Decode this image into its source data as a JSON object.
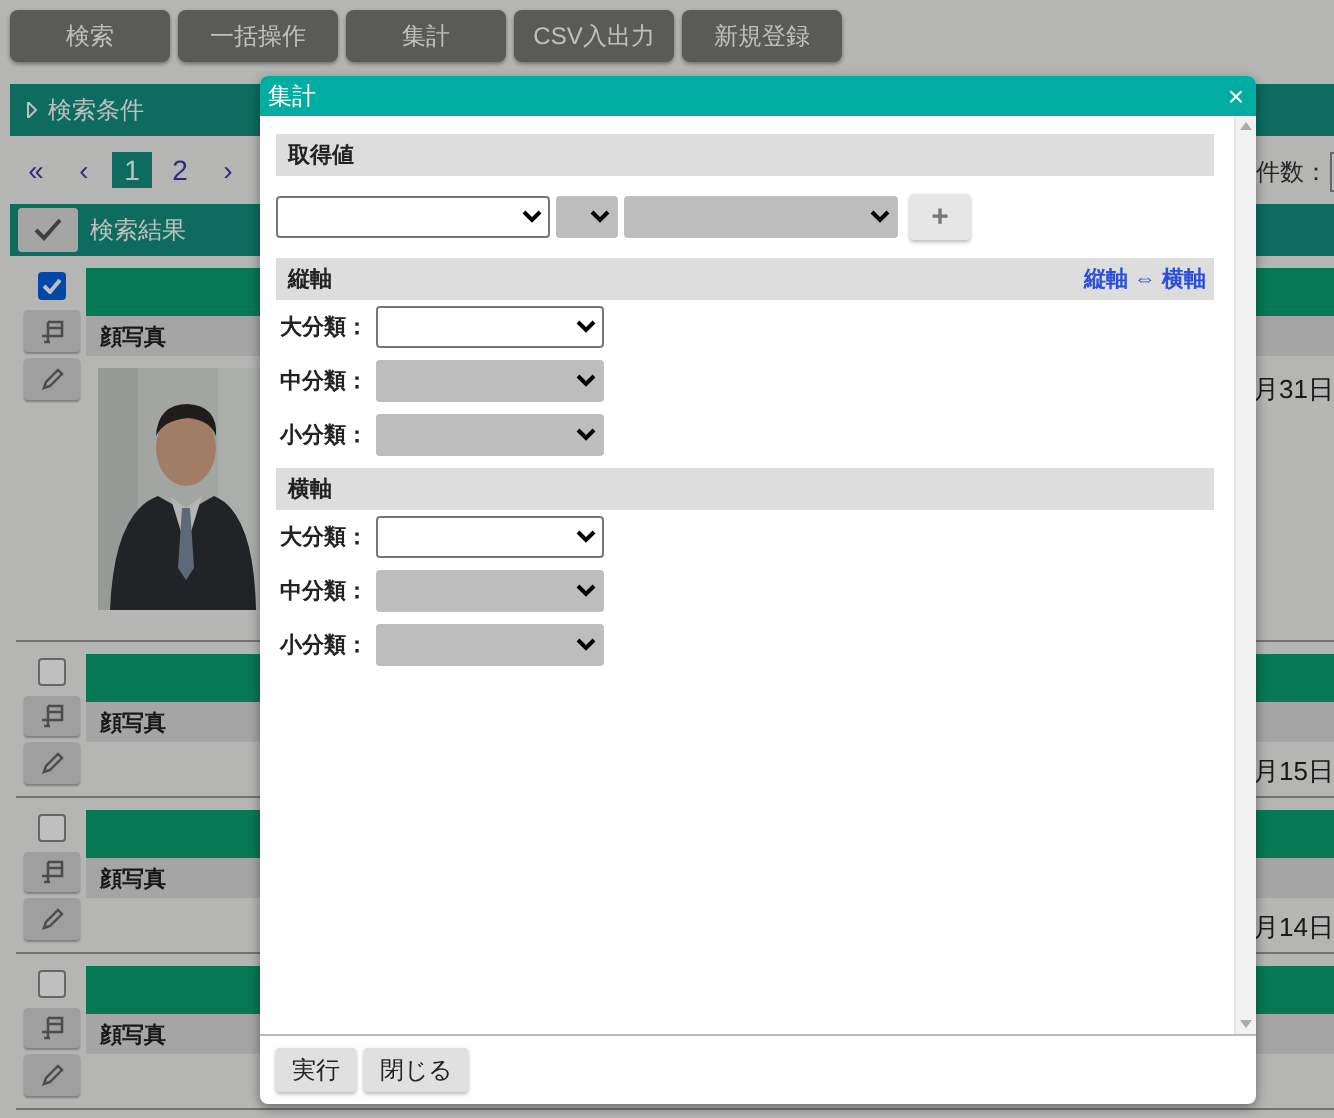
{
  "toolbar": {
    "buttons": [
      "検索",
      "一括操作",
      "集計",
      "CSV入出力",
      "新規登録"
    ]
  },
  "search_conditions": {
    "title": "検索条件",
    "expanded": false
  },
  "pagination": {
    "first": "«",
    "prev": "‹",
    "pages": [
      {
        "label": "1",
        "selected": true
      },
      {
        "label": "2",
        "selected": false
      }
    ],
    "next": "›",
    "count_label": "件数："
  },
  "results": {
    "title": "検索結果",
    "records": [
      {
        "checked": true,
        "photo_label": "顔写真",
        "date": "月31日"
      },
      {
        "checked": false,
        "photo_label": "顔写真",
        "date": "月15日"
      },
      {
        "checked": false,
        "photo_label": "顔写真",
        "date": "月14日"
      },
      {
        "checked": false,
        "photo_label": "顔写真"
      }
    ]
  },
  "dialog": {
    "title": "集計",
    "close": "×",
    "sections": [
      {
        "kind": "value",
        "title": "取得値",
        "add": "+",
        "selects": [
          {
            "disabled": false
          },
          {
            "disabled": true
          },
          {
            "disabled": true
          }
        ]
      },
      {
        "kind": "axis",
        "title": "縦軸",
        "swap_link": "縦軸 ⇔ 横軸",
        "fields": [
          {
            "label": "大分類：",
            "disabled": false
          },
          {
            "label": "中分類：",
            "disabled": true
          },
          {
            "label": "小分類：",
            "disabled": true
          }
        ]
      },
      {
        "kind": "axis",
        "title": "横軸",
        "fields": [
          {
            "label": "大分類：",
            "disabled": false
          },
          {
            "label": "中分類：",
            "disabled": true
          },
          {
            "label": "小分類：",
            "disabled": true
          }
        ]
      }
    ],
    "buttons": [
      "実行",
      "閉じる"
    ]
  }
}
